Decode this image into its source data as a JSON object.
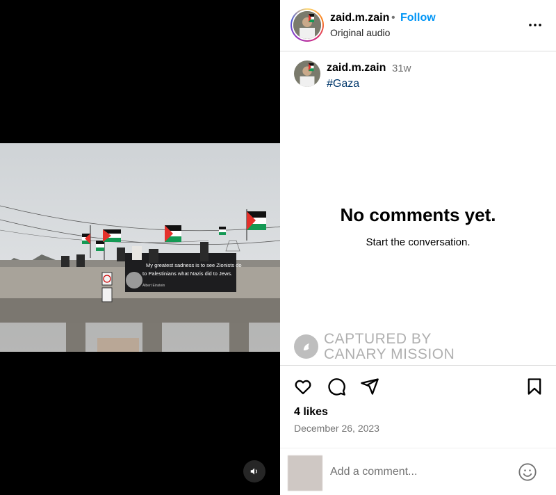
{
  "post": {
    "username": "zaid.m.zain",
    "follow_label": "Follow",
    "dot": "•",
    "audio_label": "Original audio",
    "caption_time": "31w",
    "caption_tag": "#Gaza",
    "likes": "4 likes",
    "date": "December 26, 2023"
  },
  "video": {
    "banner_text_line1": "My greatest sadness is to see Zionists do",
    "banner_text_line2": "to Palestinians what Nazis did to Jews.",
    "banner_attribution": "Albert Einstein"
  },
  "comments": {
    "empty_title": "No comments yet.",
    "empty_subtitle": "Start the conversation.",
    "input_placeholder": "Add a comment..."
  },
  "watermark": {
    "line1": "CAPTURED BY",
    "line2": "CANARY MISSION"
  },
  "icons": {
    "more": "more-horizontal-icon",
    "like": "heart-icon",
    "comment": "comment-bubble-icon",
    "share": "paper-plane-icon",
    "save": "bookmark-icon",
    "emoji": "emoji-smile-icon",
    "mute": "speaker-icon"
  },
  "colors": {
    "follow": "#0095f6",
    "hashtag": "#00376b",
    "muted_text": "#737373"
  }
}
